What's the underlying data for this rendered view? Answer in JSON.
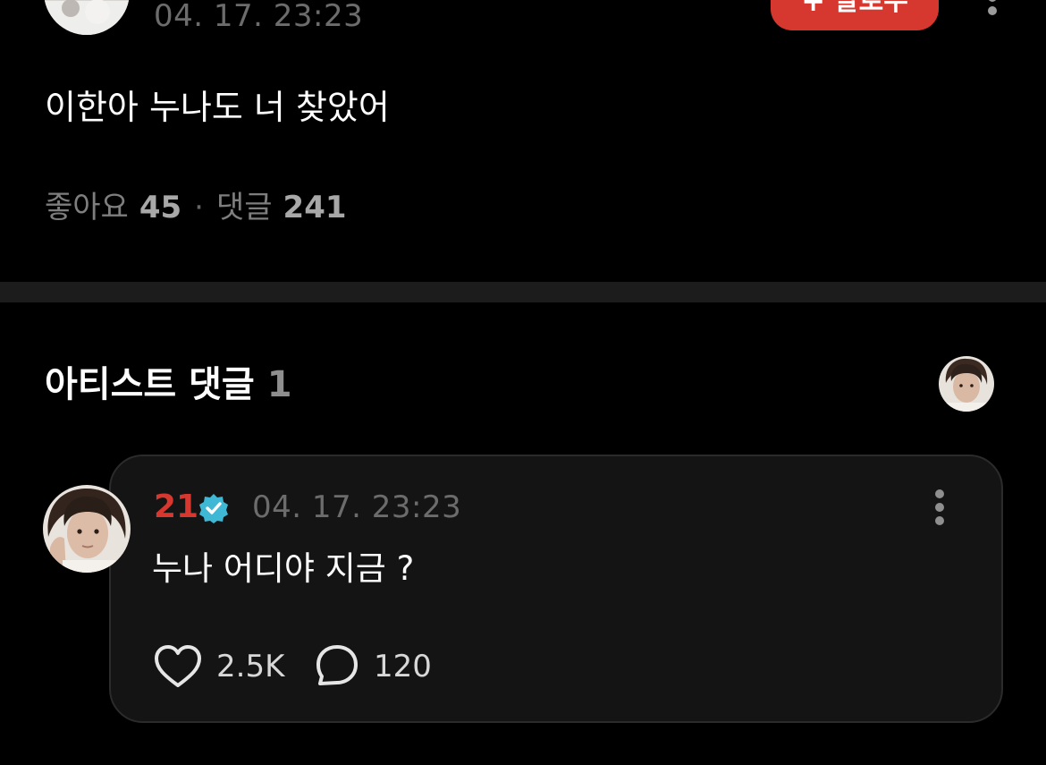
{
  "post": {
    "avatar_icon": "user-avatar-photo",
    "timestamp": "04. 17. 23:23",
    "follow_label": "팔로우",
    "follow_icon": "plus-icon",
    "more_icon": "more-vertical-icon",
    "text": "이한아 누나도 너 찾았어",
    "likes_label": "좋아요",
    "likes_count": "45",
    "separator": "·",
    "comments_label": "댓글",
    "comments_count": "241"
  },
  "artist_comments": {
    "title": "아티스트 댓글",
    "count": "1",
    "avatar_icon": "artist-avatar-photo"
  },
  "comment": {
    "author": "21",
    "verified_icon": "verified-badge-icon",
    "timestamp": "04. 17. 23:23",
    "more_icon": "more-vertical-icon",
    "text": "누나 어디야 지금 ?",
    "like_icon": "heart-icon",
    "like_count": "2.5K",
    "reply_icon": "speech-bubble-icon",
    "reply_count": "120"
  },
  "colors": {
    "background": "#000000",
    "accent_red": "#d6372e",
    "verified_blue": "#3fb8d6",
    "card_background": "#141414",
    "muted_text": "#6c6c6c"
  }
}
